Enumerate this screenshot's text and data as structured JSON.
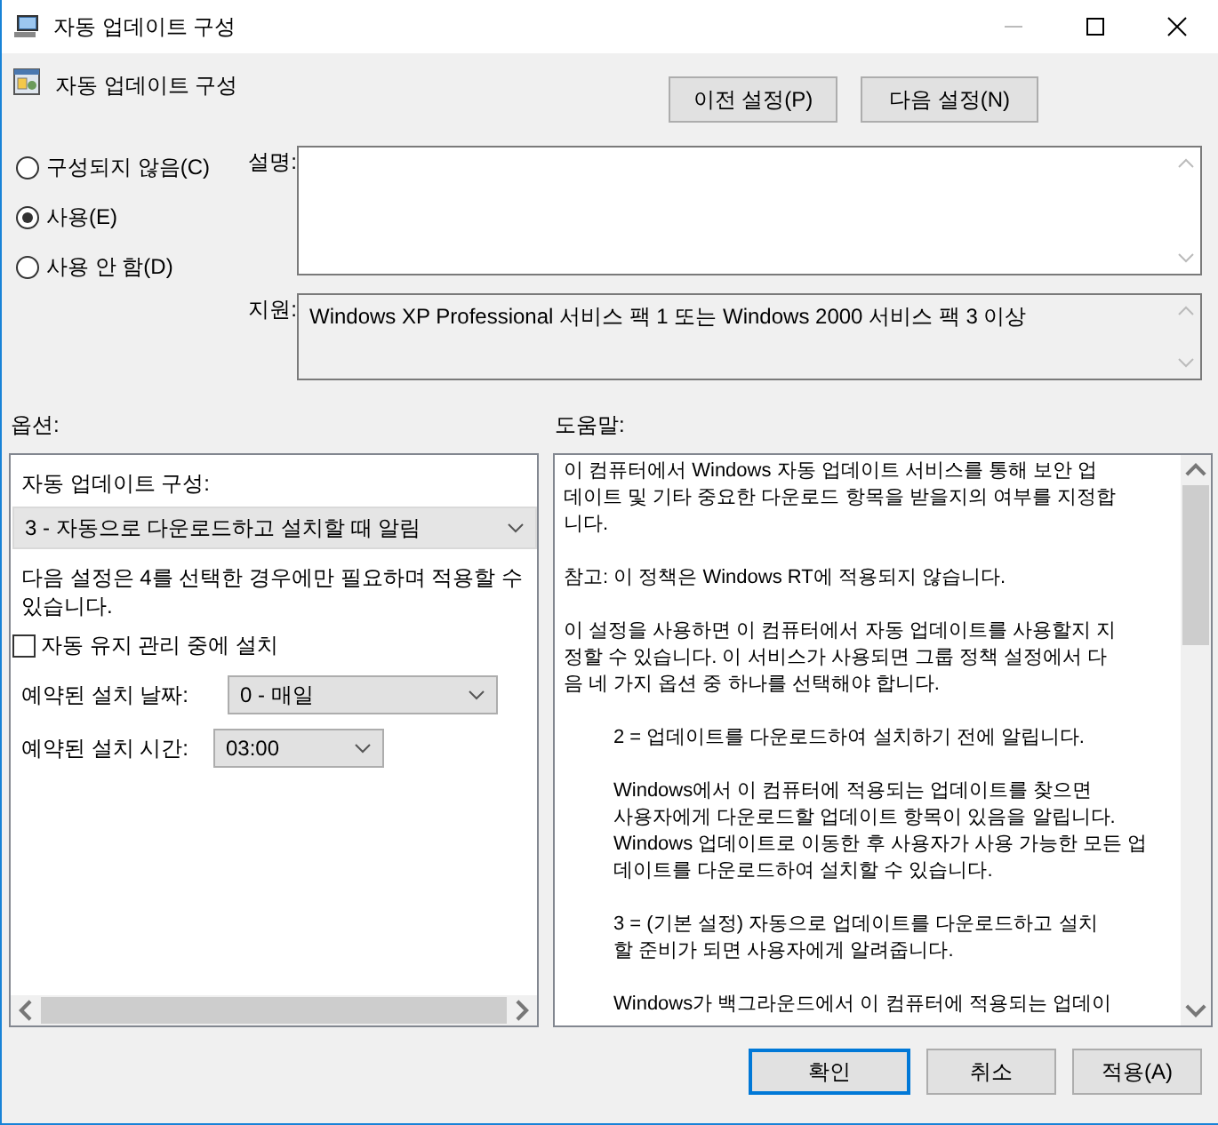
{
  "window": {
    "title": "자동 업데이트 구성"
  },
  "header": {
    "title": "자동 업데이트 구성",
    "buttons": [
      "이전 설정(P)",
      "다음 설정(N)"
    ]
  },
  "states": [
    {
      "label": "구성되지 않음(C)",
      "selected": false
    },
    {
      "label": "사용(E)",
      "selected": true
    },
    {
      "label": "사용 안 함(D)",
      "selected": false
    }
  ],
  "comment": {
    "label": "설명:"
  },
  "supported": {
    "label": "지원:",
    "value": "Windows XP Professional 서비스 팩 1 또는 Windows 2000 서비스 팩 3 이상"
  },
  "options": {
    "label": "옵션:",
    "items": [
      {
        "kind": "label",
        "text": "자동 업데이트 구성:"
      },
      {
        "kind": "select-wide",
        "value": "3 - 자동으로 다운로드하고 설치할 때 알림"
      },
      {
        "kind": "text",
        "text": "다음 설정은 4를 선택한 경우에만 필요하며 적용할 수 있습니다."
      },
      {
        "kind": "checkbox",
        "label": "자동 유지 관리 중에 설치",
        "checked": false
      },
      {
        "kind": "select",
        "label": "예약된 설치 날짜:",
        "value": "0 - 매일"
      },
      {
        "kind": "select",
        "label": "예약된 설치 시간:",
        "value": "03:00"
      }
    ]
  },
  "help": {
    "label": "도움말:",
    "paragraphs": [
      {
        "indent": false,
        "lines": [
          "이 컴퓨터에서 Windows 자동 업데이트 서비스를 통해 보안 업",
          "데이트 및 기타 중요한 다운로드 항목을 받을지의 여부를 지정합",
          "니다."
        ]
      },
      {
        "indent": false,
        "lines": [
          "참고: 이 정책은 Windows RT에 적용되지 않습니다."
        ]
      },
      {
        "indent": false,
        "lines": [
          "이 설정을 사용하면 이 컴퓨터에서 자동 업데이트를 사용할지 지",
          "정할 수 있습니다. 이 서비스가 사용되면 그룹 정책 설정에서 다",
          "음 네 가지 옵션 중 하나를 선택해야 합니다."
        ]
      },
      {
        "indent": true,
        "lines": [
          "2 = 업데이트를 다운로드하여 설치하기 전에 알립니다."
        ]
      },
      {
        "indent": true,
        "lines": [
          "Windows에서 이 컴퓨터에 적용되는 업데이트를 찾으면",
          "사용자에게 다운로드할 업데이트 항목이 있음을 알립니다.",
          "Windows 업데이트로 이동한 후 사용자가 사용 가능한 모든 업",
          "데이트를 다운로드하여 설치할 수 있습니다."
        ]
      },
      {
        "indent": true,
        "lines": [
          "3 = (기본 설정) 자동으로 업데이트를 다운로드하고 설치",
          "할 준비가 되면 사용자에게 알려줍니다."
        ]
      },
      {
        "indent": true,
        "lines": [
          "Windows가 백그라운드에서 이 컴퓨터에 적용되는 업데이"
        ]
      }
    ]
  },
  "footer": [
    {
      "label": "확인",
      "default": true
    },
    {
      "label": "취소",
      "default": false
    },
    {
      "label": "적용(A)",
      "default": false
    }
  ]
}
